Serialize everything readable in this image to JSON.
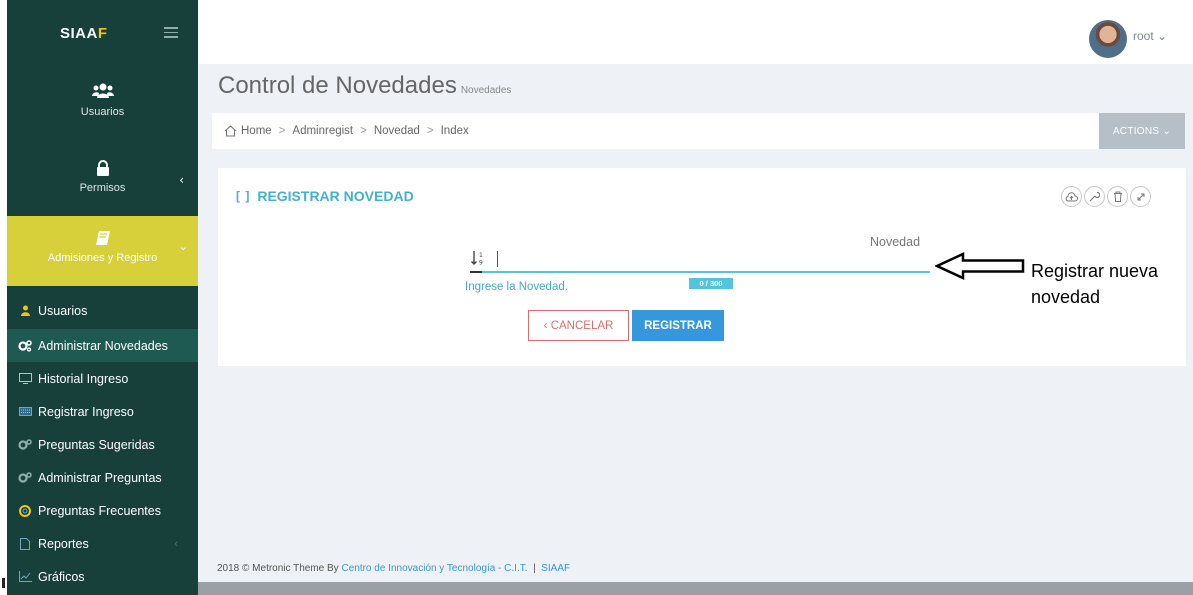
{
  "brand": {
    "prefix": "SIAA",
    "suffix": "F"
  },
  "sidebar": {
    "main_items": [
      {
        "label": "Usuarios",
        "icon": "users-icon"
      },
      {
        "label": "Permisos",
        "icon": "lock-icon"
      },
      {
        "label": "Admisiones y Registro",
        "icon": "book-icon"
      }
    ],
    "sub_items": [
      {
        "label": "Usuarios",
        "icon": "user-icon"
      },
      {
        "label": "Administrar Novedades",
        "icon": "cogs-icon"
      },
      {
        "label": "Historial Ingreso",
        "icon": "monitor-icon"
      },
      {
        "label": "Registrar Ingreso",
        "icon": "keyboard-icon"
      },
      {
        "label": "Preguntas Sugeridas",
        "icon": "cogs-icon"
      },
      {
        "label": "Administrar Preguntas",
        "icon": "cogs-icon"
      },
      {
        "label": "Preguntas Frecuentes",
        "icon": "lifebuoy-icon"
      },
      {
        "label": "Reportes",
        "icon": "document-icon"
      },
      {
        "label": "Gráficos",
        "icon": "chart-icon"
      }
    ]
  },
  "topbar": {
    "username": "root"
  },
  "page": {
    "title": "Control de Novedades",
    "subtitle": "Novedades"
  },
  "breadcrumb": [
    "Home",
    "Adminregist",
    "Novedad",
    "Index"
  ],
  "actions_label": "ACTIONS",
  "portlet": {
    "title": "REGISTRAR NOVEDAD",
    "field_label": "Novedad",
    "field_hint": "Ingrese la Novedad.",
    "counter": "0 / 300",
    "cancel_label": "CANCELAR",
    "save_label": "REGISTRAR"
  },
  "annotation": {
    "line1": "Registrar nueva",
    "line2": "novedad"
  },
  "footer": {
    "prefix": "2018 © Metronic Theme By",
    "org": "Centro de Innovación y Tecnología - C.I.T.",
    "separator": "|",
    "app": "SIAAF"
  },
  "colors": {
    "sidebar": "#17403a",
    "active": "#d7d03b",
    "accent": "#44b0d0",
    "primary": "#3598dc",
    "danger": "#e26a6a"
  }
}
